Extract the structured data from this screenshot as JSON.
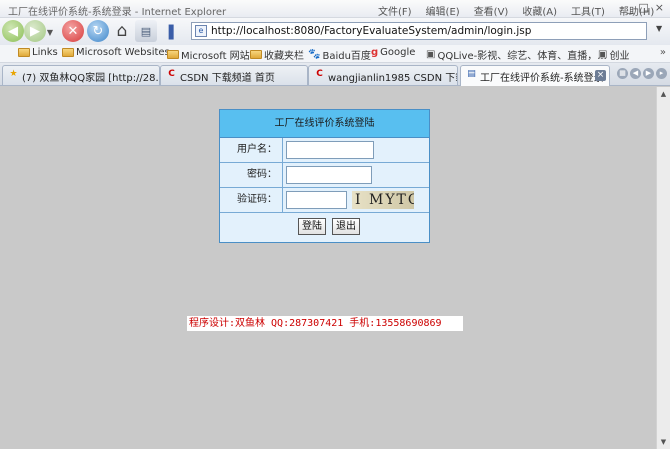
{
  "window": {
    "title": "工厂在线评价系统-系统登录 - Internet Explorer",
    "menu": [
      "文件(F)",
      "编辑(E)",
      "查看(V)",
      "收藏(A)",
      "工具(T)",
      "帮助(H)"
    ],
    "controls": [
      "_",
      "□",
      "×"
    ]
  },
  "navbar": {
    "address": "http://localhost:8080/FactoryEvaluateSystem/admin/login.jsp"
  },
  "favorites": {
    "items": [
      {
        "label": "Links",
        "icon": "folder-icon"
      },
      {
        "label": "Microsoft Websites",
        "icon": "folder-icon"
      },
      {
        "label": "Microsoft 网站",
        "icon": "folder-icon"
      },
      {
        "label": "收藏夹栏",
        "icon": "folder-icon"
      },
      {
        "label": "Baidu百度",
        "icon": "baidu-icon"
      },
      {
        "label": "Google",
        "icon": "google-icon"
      },
      {
        "label": "QQLive-影视、综艺、体育、直播，...",
        "icon": "page-icon"
      },
      {
        "label": "创业",
        "icon": "page-icon"
      }
    ],
    "more": "»"
  },
  "tabs": [
    {
      "label": "(7) 双鱼林QQ家园 [http://28...",
      "icon": "star-icon"
    },
    {
      "label": "CSDN 下载频道 首页",
      "icon": "csdn-icon"
    },
    {
      "label": "wangjianlin1985 CSDN 下载...",
      "icon": "csdn-icon"
    },
    {
      "label": "工厂在线评价系统-系统登录",
      "icon": "page-icon",
      "active": true
    }
  ],
  "login": {
    "heading": "工厂在线评价系统登陆",
    "username_label": "用户名：",
    "username_value": "",
    "password_label": "密码：",
    "password_value": "",
    "captcha_label": "验证码：",
    "captcha_value": "",
    "captcha_text": "I MYTQ",
    "login_button": "登陆",
    "exit_button": "退出"
  },
  "footer": {
    "credit": "程序设计:双鱼林 QQ:287307421 手机:13558690869"
  }
}
